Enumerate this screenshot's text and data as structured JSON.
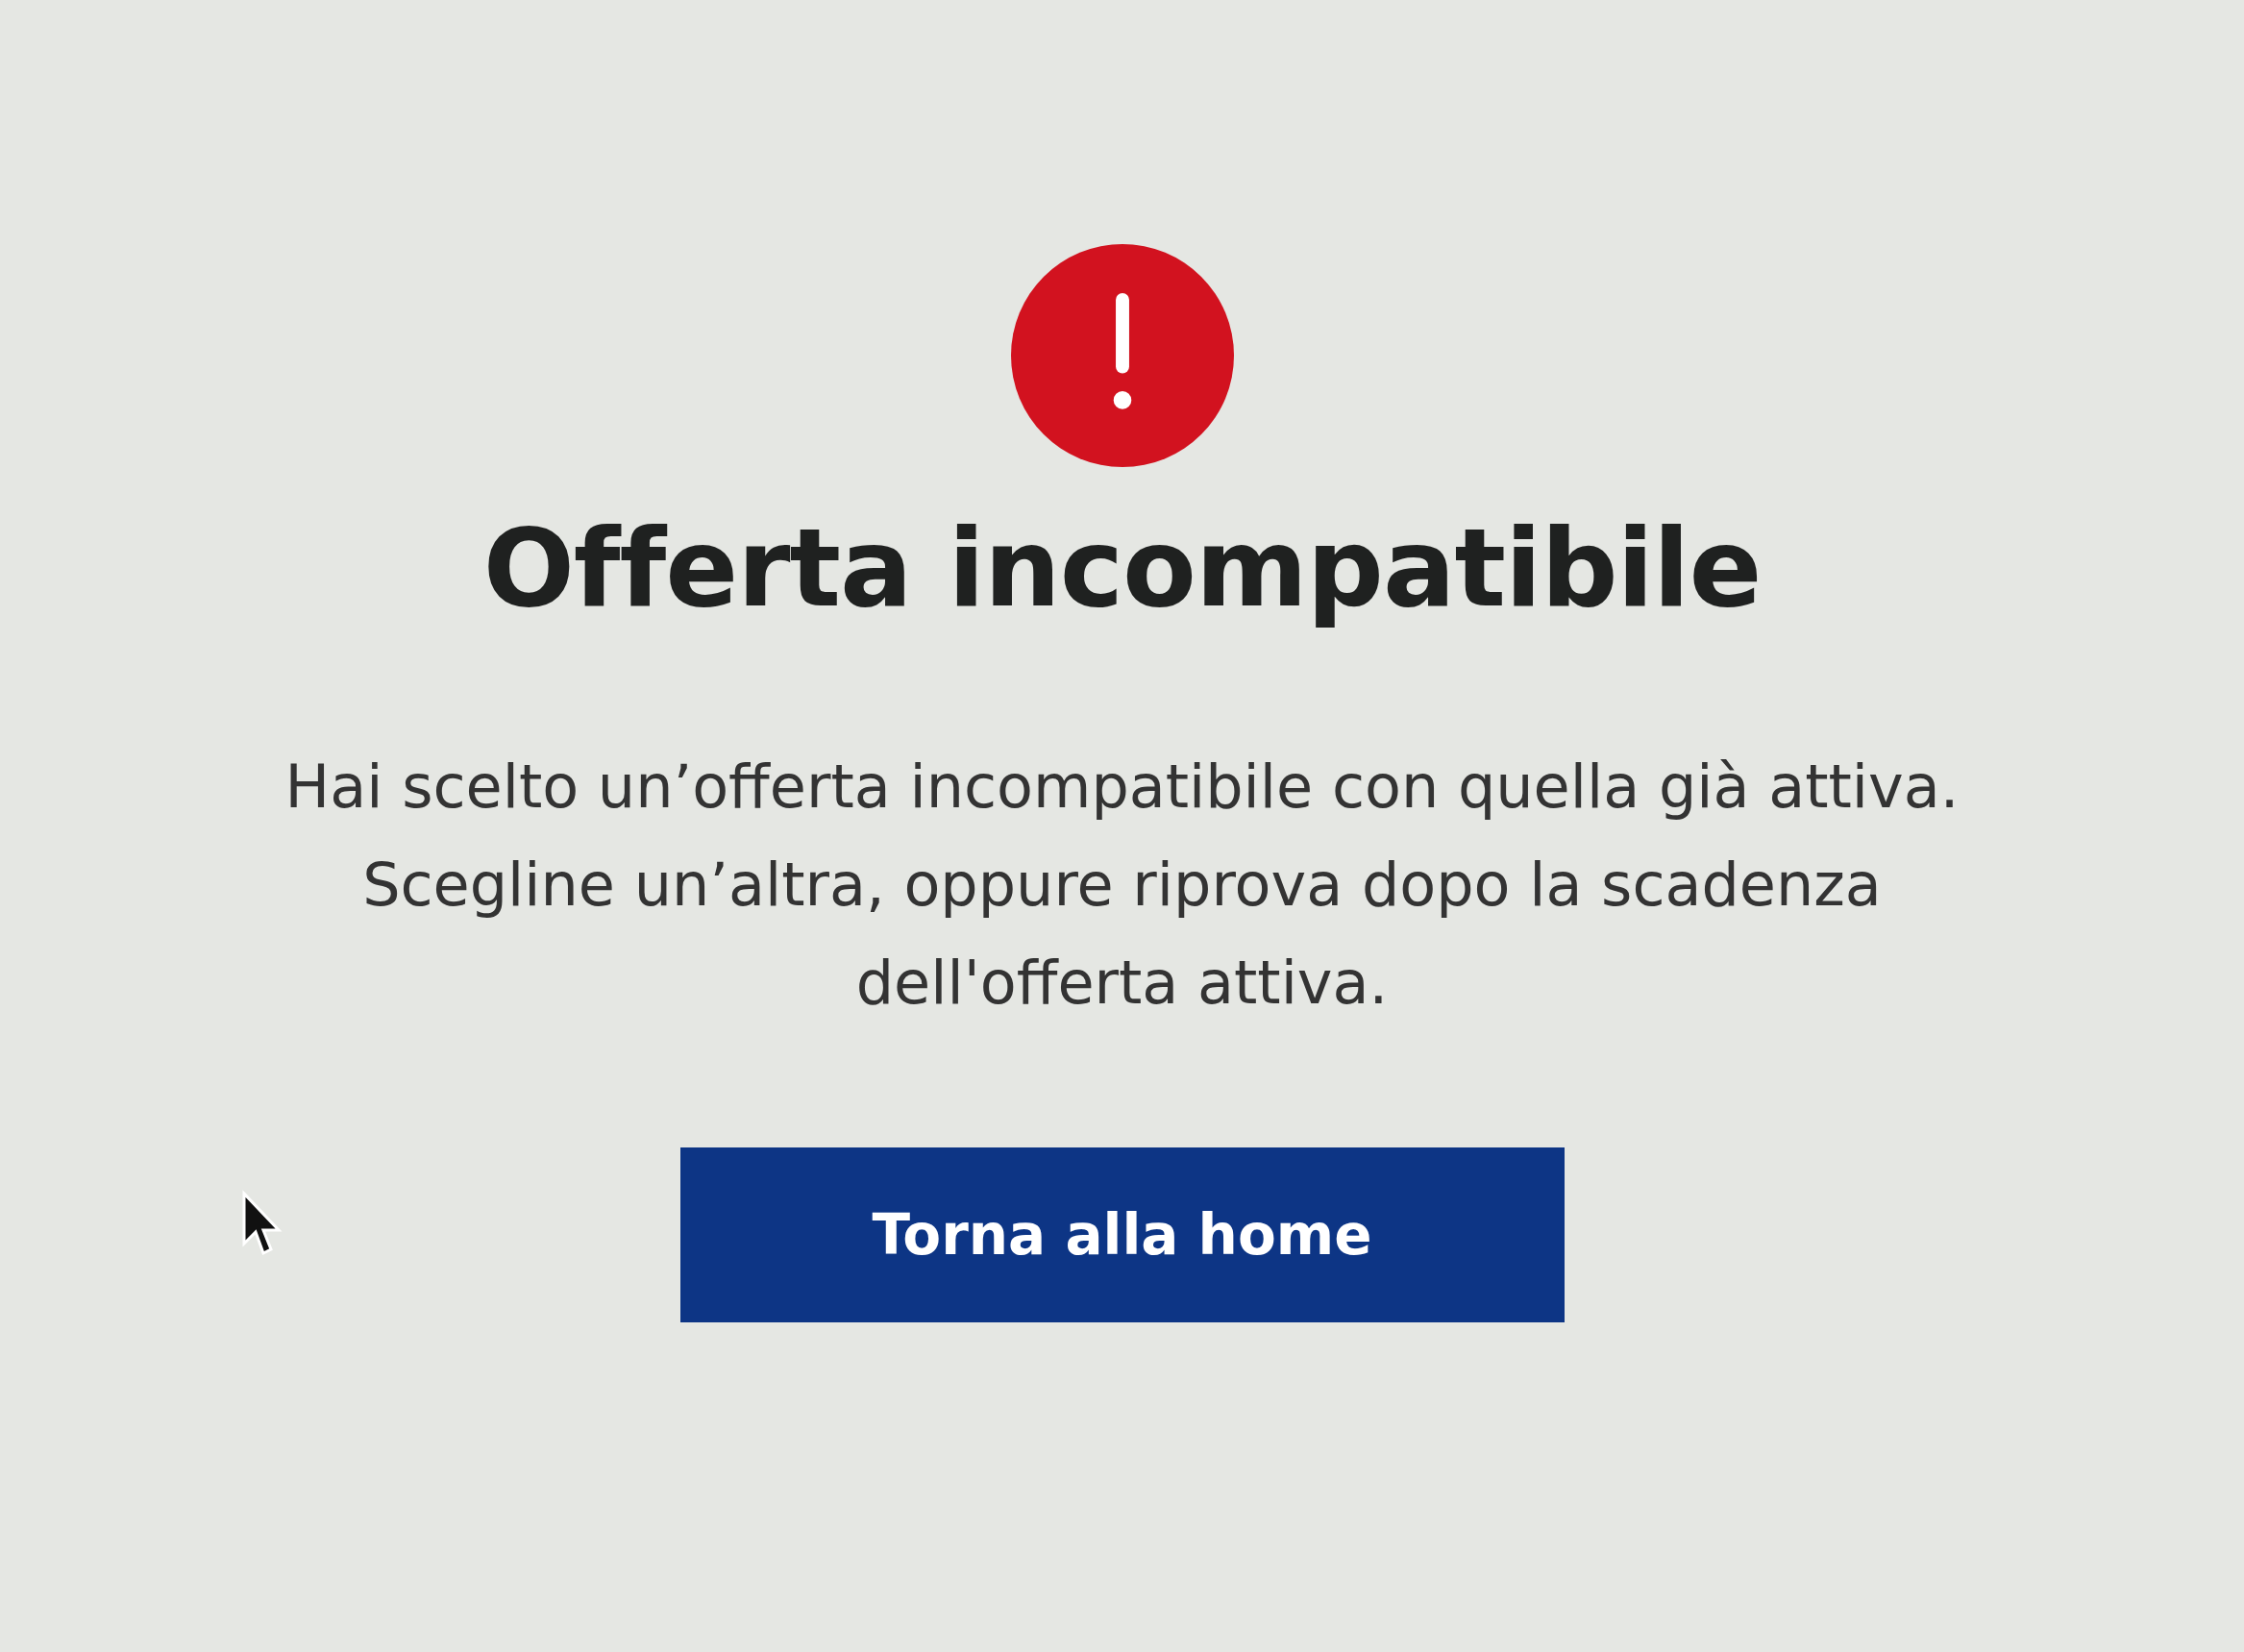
{
  "alert": {
    "kind": "error"
  },
  "title": "Offerta incompatibile",
  "message": [
    "Hai scelto un’offerta incompatibile con quella già attiva.",
    "Scegline un’altra, oppure riprova dopo la scadenza",
    "dell'offerta attiva."
  ],
  "button": "Torna alla home"
}
